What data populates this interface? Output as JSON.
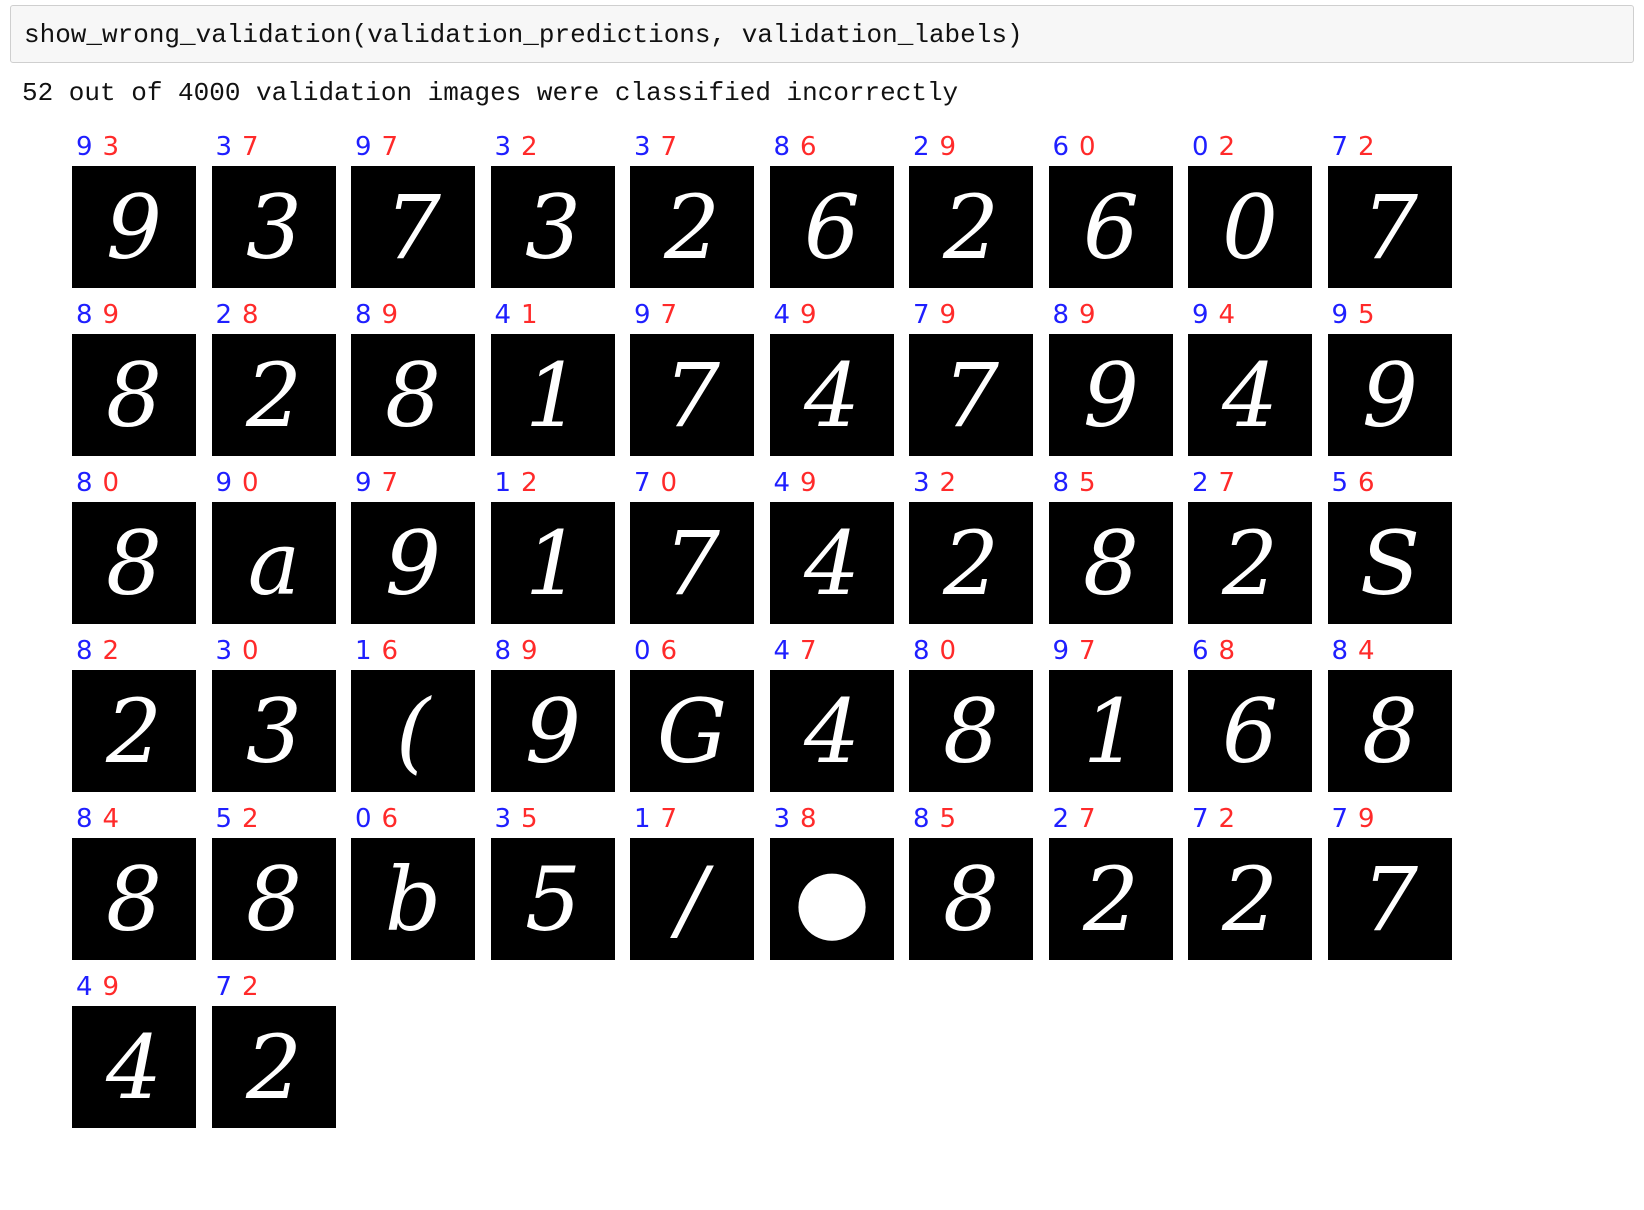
{
  "cell": {
    "code": "show_wrong_validation(validation_predictions, validation_labels)"
  },
  "output": {
    "text": "52 out of 4000 validation images were classified incorrectly"
  },
  "images": [
    {
      "pred": "9",
      "label": "3",
      "glyph": "9"
    },
    {
      "pred": "3",
      "label": "7",
      "glyph": "3"
    },
    {
      "pred": "9",
      "label": "7",
      "glyph": "7"
    },
    {
      "pred": "3",
      "label": "2",
      "glyph": "3"
    },
    {
      "pred": "3",
      "label": "7",
      "glyph": "2"
    },
    {
      "pred": "8",
      "label": "6",
      "glyph": "6"
    },
    {
      "pred": "2",
      "label": "9",
      "glyph": "2"
    },
    {
      "pred": "6",
      "label": "0",
      "glyph": "6"
    },
    {
      "pred": "0",
      "label": "2",
      "glyph": "0"
    },
    {
      "pred": "7",
      "label": "2",
      "glyph": "7"
    },
    {
      "pred": "8",
      "label": "9",
      "glyph": "8"
    },
    {
      "pred": "2",
      "label": "8",
      "glyph": "2"
    },
    {
      "pred": "8",
      "label": "9",
      "glyph": "8"
    },
    {
      "pred": "4",
      "label": "1",
      "glyph": "1"
    },
    {
      "pred": "9",
      "label": "7",
      "glyph": "7"
    },
    {
      "pred": "4",
      "label": "9",
      "glyph": "4"
    },
    {
      "pred": "7",
      "label": "9",
      "glyph": "7"
    },
    {
      "pred": "8",
      "label": "9",
      "glyph": "9"
    },
    {
      "pred": "9",
      "label": "4",
      "glyph": "4"
    },
    {
      "pred": "9",
      "label": "5",
      "glyph": "9"
    },
    {
      "pred": "8",
      "label": "0",
      "glyph": "8"
    },
    {
      "pred": "9",
      "label": "0",
      "glyph": "a"
    },
    {
      "pred": "9",
      "label": "7",
      "glyph": "9"
    },
    {
      "pred": "1",
      "label": "2",
      "glyph": "1"
    },
    {
      "pred": "7",
      "label": "0",
      "glyph": "7"
    },
    {
      "pred": "4",
      "label": "9",
      "glyph": "4"
    },
    {
      "pred": "3",
      "label": "2",
      "glyph": "2"
    },
    {
      "pred": "8",
      "label": "5",
      "glyph": "8"
    },
    {
      "pred": "2",
      "label": "7",
      "glyph": "2"
    },
    {
      "pred": "5",
      "label": "6",
      "glyph": "S"
    },
    {
      "pred": "8",
      "label": "2",
      "glyph": "2"
    },
    {
      "pred": "3",
      "label": "0",
      "glyph": "3"
    },
    {
      "pred": "1",
      "label": "6",
      "glyph": "("
    },
    {
      "pred": "8",
      "label": "9",
      "glyph": "9"
    },
    {
      "pred": "0",
      "label": "6",
      "glyph": "G"
    },
    {
      "pred": "4",
      "label": "7",
      "glyph": "4"
    },
    {
      "pred": "8",
      "label": "0",
      "glyph": "8"
    },
    {
      "pred": "9",
      "label": "7",
      "glyph": "1"
    },
    {
      "pred": "6",
      "label": "8",
      "glyph": "6"
    },
    {
      "pred": "8",
      "label": "4",
      "glyph": "8"
    },
    {
      "pred": "8",
      "label": "4",
      "glyph": "8"
    },
    {
      "pred": "5",
      "label": "2",
      "glyph": "8"
    },
    {
      "pred": "0",
      "label": "6",
      "glyph": "b"
    },
    {
      "pred": "3",
      "label": "5",
      "glyph": "5"
    },
    {
      "pred": "1",
      "label": "7",
      "glyph": "/"
    },
    {
      "pred": "3",
      "label": "8",
      "glyph": "●"
    },
    {
      "pred": "8",
      "label": "5",
      "glyph": "8"
    },
    {
      "pred": "2",
      "label": "7",
      "glyph": "2"
    },
    {
      "pred": "7",
      "label": "2",
      "glyph": "2"
    },
    {
      "pred": "7",
      "label": "9",
      "glyph": "7"
    },
    {
      "pred": "4",
      "label": "9",
      "glyph": "4"
    },
    {
      "pred": "7",
      "label": "2",
      "glyph": "2"
    }
  ],
  "colors": {
    "pred": "#1f1fff",
    "label": "#ff2a2a",
    "image_bg": "#000000",
    "stroke": "#ffffff"
  }
}
